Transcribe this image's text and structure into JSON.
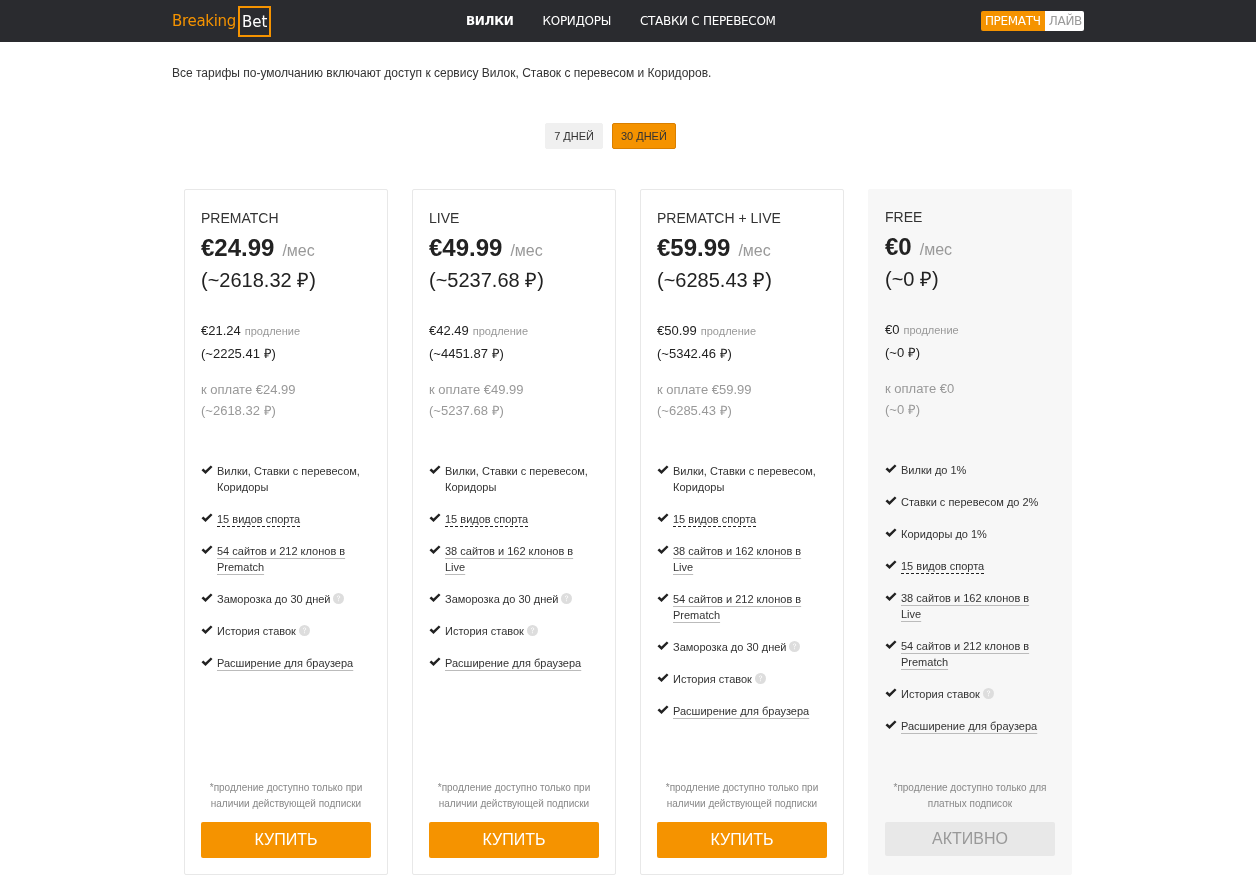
{
  "header": {
    "logo": {
      "word": "Breaking",
      "boxed": "Bet"
    },
    "nav": [
      {
        "label": "ВИЛКИ",
        "selected": true
      },
      {
        "label": "КОРИДОРЫ",
        "selected": false
      },
      {
        "label": "СТАВКИ С ПЕРЕВЕСОМ",
        "selected": false
      }
    ],
    "mode_toggle": [
      {
        "label": "ПРЕМАТЧ",
        "selected": true
      },
      {
        "label": "ЛАЙВ",
        "selected": false
      }
    ]
  },
  "intro": "Все тарифы по-умолчанию включают доступ к сервису Вилок, Ставок с перевесом и Коридоров.",
  "periods": [
    {
      "label": "7 ДНЕЙ",
      "selected": false
    },
    {
      "label": "30 ДНЕЙ",
      "selected": true
    }
  ],
  "plans": [
    {
      "name": "PREMATCH",
      "price": "€24.99",
      "per": "/мес",
      "price_rub": "(~2618.32 ₽)",
      "renewal": "€21.24",
      "renewal_label": "продление",
      "renewal_rub": "(~2225.41 ₽)",
      "to_pay": "к оплате €24.99",
      "to_pay_rub": "(~2618.32 ₽)",
      "current": false,
      "features": [
        {
          "text": "Вилки, Ставки с перевесом, Коридоры",
          "kind": "plain",
          "help": false
        },
        {
          "text": "15 видов спорта",
          "kind": "dotted",
          "help": false
        },
        {
          "text": "54 сайтов и 212 клонов в Prematch",
          "kind": "link",
          "help": false
        },
        {
          "text": "Заморозка до 30 дней",
          "kind": "plain",
          "help": true
        },
        {
          "text": "История ставок",
          "kind": "plain",
          "help": true
        },
        {
          "text": "Расширение для браузера",
          "kind": "link",
          "help": false
        }
      ],
      "note": "*продление доступно только при наличии действующей подписки",
      "button": "КУПИТЬ"
    },
    {
      "name": "LIVE",
      "price": "€49.99",
      "per": "/мес",
      "price_rub": "(~5237.68 ₽)",
      "renewal": "€42.49",
      "renewal_label": "продление",
      "renewal_rub": "(~4451.87 ₽)",
      "to_pay": "к оплате €49.99",
      "to_pay_rub": "(~5237.68 ₽)",
      "current": false,
      "features": [
        {
          "text": "Вилки, Ставки с перевесом, Коридоры",
          "kind": "plain",
          "help": false
        },
        {
          "text": "15 видов спорта",
          "kind": "dotted",
          "help": false
        },
        {
          "text": "38 сайтов и 162 клонов в Live",
          "kind": "link",
          "help": false
        },
        {
          "text": "Заморозка до 30 дней",
          "kind": "plain",
          "help": true
        },
        {
          "text": "История ставок",
          "kind": "plain",
          "help": true
        },
        {
          "text": "Расширение для браузера",
          "kind": "link",
          "help": false
        }
      ],
      "note": "*продление доступно только при наличии действующей подписки",
      "button": "КУПИТЬ"
    },
    {
      "name": "PREMATCH + LIVE",
      "price": "€59.99",
      "per": "/мес",
      "price_rub": "(~6285.43 ₽)",
      "renewal": "€50.99",
      "renewal_label": "продление",
      "renewal_rub": "(~5342.46 ₽)",
      "to_pay": "к оплате €59.99",
      "to_pay_rub": "(~6285.43 ₽)",
      "current": false,
      "features": [
        {
          "text": "Вилки, Ставки с перевесом, Коридоры",
          "kind": "plain",
          "help": false
        },
        {
          "text": "15 видов спорта",
          "kind": "dotted",
          "help": false
        },
        {
          "text": "38 сайтов и 162 клонов в Live",
          "kind": "link",
          "help": false
        },
        {
          "text": "54 сайтов и 212 клонов в Prematch",
          "kind": "link",
          "help": false
        },
        {
          "text": "Заморозка до 30 дней",
          "kind": "plain",
          "help": true
        },
        {
          "text": "История ставок",
          "kind": "plain",
          "help": true
        },
        {
          "text": "Расширение для браузера",
          "kind": "link",
          "help": false
        }
      ],
      "note": "*продление доступно только при наличии действующей подписки",
      "button": "КУПИТЬ"
    },
    {
      "name": "FREE",
      "price": "€0",
      "per": "/мес",
      "price_rub": "(~0 ₽)",
      "renewal": "€0",
      "renewal_label": "продление",
      "renewal_rub": "(~0 ₽)",
      "to_pay": "к оплате €0",
      "to_pay_rub": "(~0 ₽)",
      "current": true,
      "features": [
        {
          "text": "Вилки до 1%",
          "kind": "plain",
          "help": false
        },
        {
          "text": "Ставки с перевесом до 2%",
          "kind": "plain",
          "help": false
        },
        {
          "text": "Коридоры до 1%",
          "kind": "plain",
          "help": false
        },
        {
          "text": "15 видов спорта",
          "kind": "dotted",
          "help": false
        },
        {
          "text": "38 сайтов и 162 клонов в Live",
          "kind": "link",
          "help": false
        },
        {
          "text": "54 сайтов и 212 клонов в Prematch",
          "kind": "link",
          "help": false
        },
        {
          "text": "История ставок",
          "kind": "plain",
          "help": true
        },
        {
          "text": "Расширение для браузера",
          "kind": "link",
          "help": false
        }
      ],
      "note": "*продление доступно только для платных подписок",
      "button": "АКТИВНО"
    }
  ]
}
